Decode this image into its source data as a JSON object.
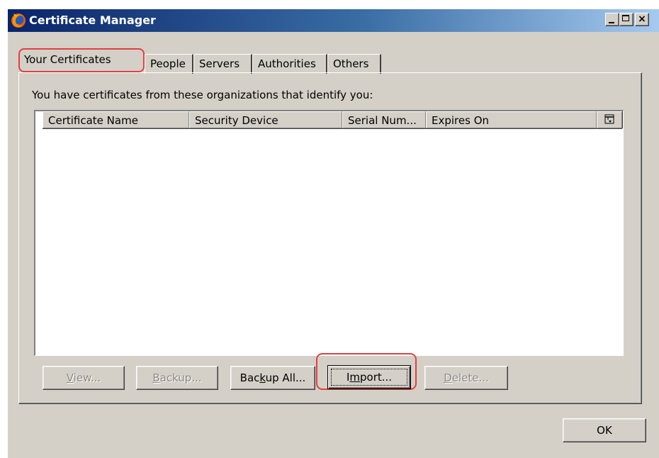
{
  "window": {
    "title": "Certificate Manager",
    "icon": "firefox-icon",
    "controls": {
      "minimize": "minimize-icon",
      "maximize": "maximize-icon",
      "close": "×"
    }
  },
  "tabs": [
    {
      "label": "Your Certificates",
      "selected": true
    },
    {
      "label": "People",
      "selected": false
    },
    {
      "label": "Servers",
      "selected": false
    },
    {
      "label": "Authorities",
      "selected": false
    },
    {
      "label": "Others",
      "selected": false
    }
  ],
  "panel": {
    "intro": "You have certificates from these organizations that identify you:",
    "columns": [
      "Certificate Name",
      "Security Device",
      "Serial Num...",
      "Expires On"
    ],
    "column_picker_icon": "column-picker-icon",
    "rows": []
  },
  "buttons": {
    "view": {
      "pre": "",
      "mn": "V",
      "post": "iew...",
      "enabled": false
    },
    "backup": {
      "pre": "",
      "mn": "B",
      "post": "ackup...",
      "enabled": false
    },
    "backup_all": {
      "pre": "Bac",
      "mn": "k",
      "post": "up All...",
      "enabled": true
    },
    "import": {
      "pre": "I",
      "mn": "m",
      "post": "port...",
      "enabled": true,
      "focused": true
    },
    "delete": {
      "pre": "",
      "mn": "D",
      "post": "elete...",
      "enabled": false
    }
  },
  "ok_label": "OK",
  "highlight_color": "#e04040"
}
